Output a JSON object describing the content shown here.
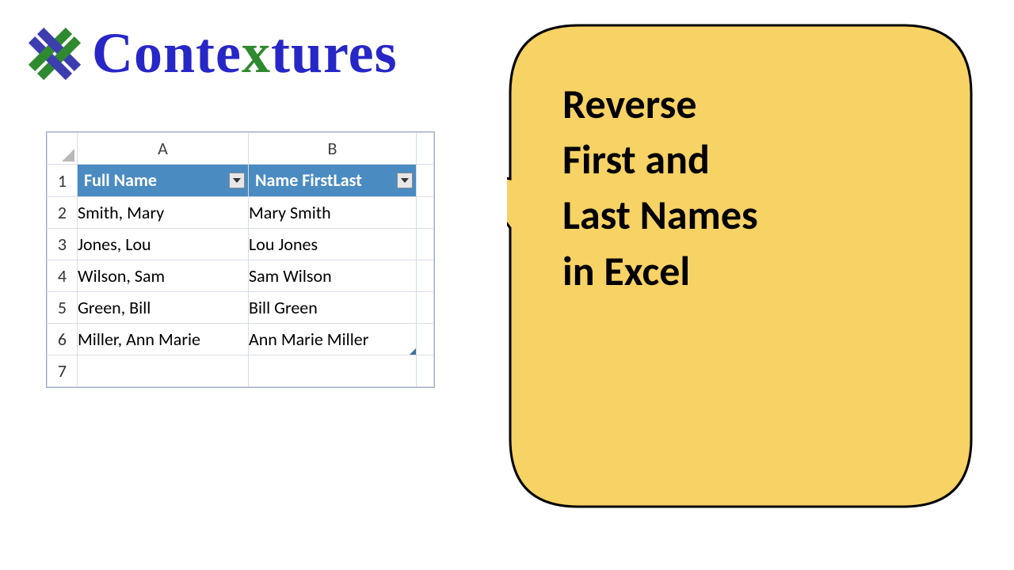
{
  "brand": {
    "name_pre": "Conte",
    "name_x": "x",
    "name_post": "tures"
  },
  "sheet": {
    "col_labels": [
      "A",
      "B"
    ],
    "row_labels": [
      "1",
      "2",
      "3",
      "4",
      "5",
      "6",
      "7"
    ],
    "headers": {
      "a": "Full Name",
      "b": "Name FirstLast"
    },
    "rows": [
      {
        "a": "Smith, Mary",
        "b": "Mary Smith"
      },
      {
        "a": "Jones, Lou",
        "b": "Lou Jones"
      },
      {
        "a": "Wilson, Sam",
        "b": "Sam Wilson"
      },
      {
        "a": "Green, Bill",
        "b": "Bill Green"
      },
      {
        "a": "Miller, Ann Marie",
        "b": "Ann Marie Miller"
      }
    ]
  },
  "callout": {
    "line1": "Reverse",
    "line2": "First and",
    "line3": "Last Names",
    "line4": "in Excel"
  }
}
